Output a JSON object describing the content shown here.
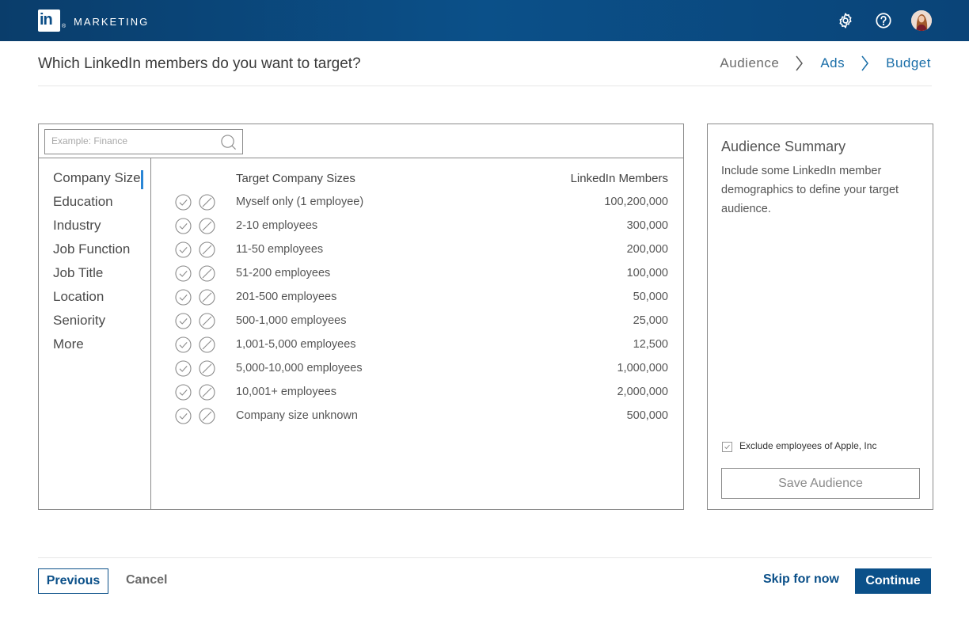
{
  "brand": {
    "logo_text": "in",
    "registered": "®",
    "label": "MARKETING"
  },
  "header": {
    "title": "Which LinkedIn members do you want to target?",
    "breadcrumbs": [
      "Audience",
      "Ads",
      "Budget"
    ]
  },
  "search": {
    "placeholder": "Example: Finance",
    "value": ""
  },
  "categories": [
    "Company Size",
    "Education",
    "Industry",
    "Job Function",
    "Job Title",
    "Location",
    "Seniority",
    "More"
  ],
  "active_category": "Company Size",
  "table": {
    "col_label": "Target Company Sizes",
    "col_count": "LinkedIn Members",
    "rows": [
      {
        "label": "Myself only (1 employee)",
        "count": "100,200,000"
      },
      {
        "label": "2-10 employees",
        "count": "300,000"
      },
      {
        "label": "11-50 employees",
        "count": "200,000"
      },
      {
        "label": "51-200 employees",
        "count": "100,000"
      },
      {
        "label": "201-500 employees",
        "count": "50,000"
      },
      {
        "label": "500-1,000 employees",
        "count": "25,000"
      },
      {
        "label": "1,001-5,000 employees",
        "count": "12,500"
      },
      {
        "label": "5,000-10,000 employees",
        "count": "1,000,000"
      },
      {
        "label": "10,001+ employees",
        "count": "2,000,000"
      },
      {
        "label": "Company size unknown",
        "count": "500,000"
      }
    ]
  },
  "summary": {
    "title": "Audience Summary",
    "description": "Include some LinkedIn member demographics to define your target audience.",
    "exclude_label": "Exclude employees of Apple, Inc",
    "exclude_checked": true,
    "save_label": "Save Audience"
  },
  "footer": {
    "previous": "Previous",
    "cancel": "Cancel",
    "skip": "Skip for now",
    "continue": "Continue"
  },
  "colors": {
    "topbar": "#0b5089",
    "accent": "#2a86d6",
    "link": "#1a6ea8"
  }
}
